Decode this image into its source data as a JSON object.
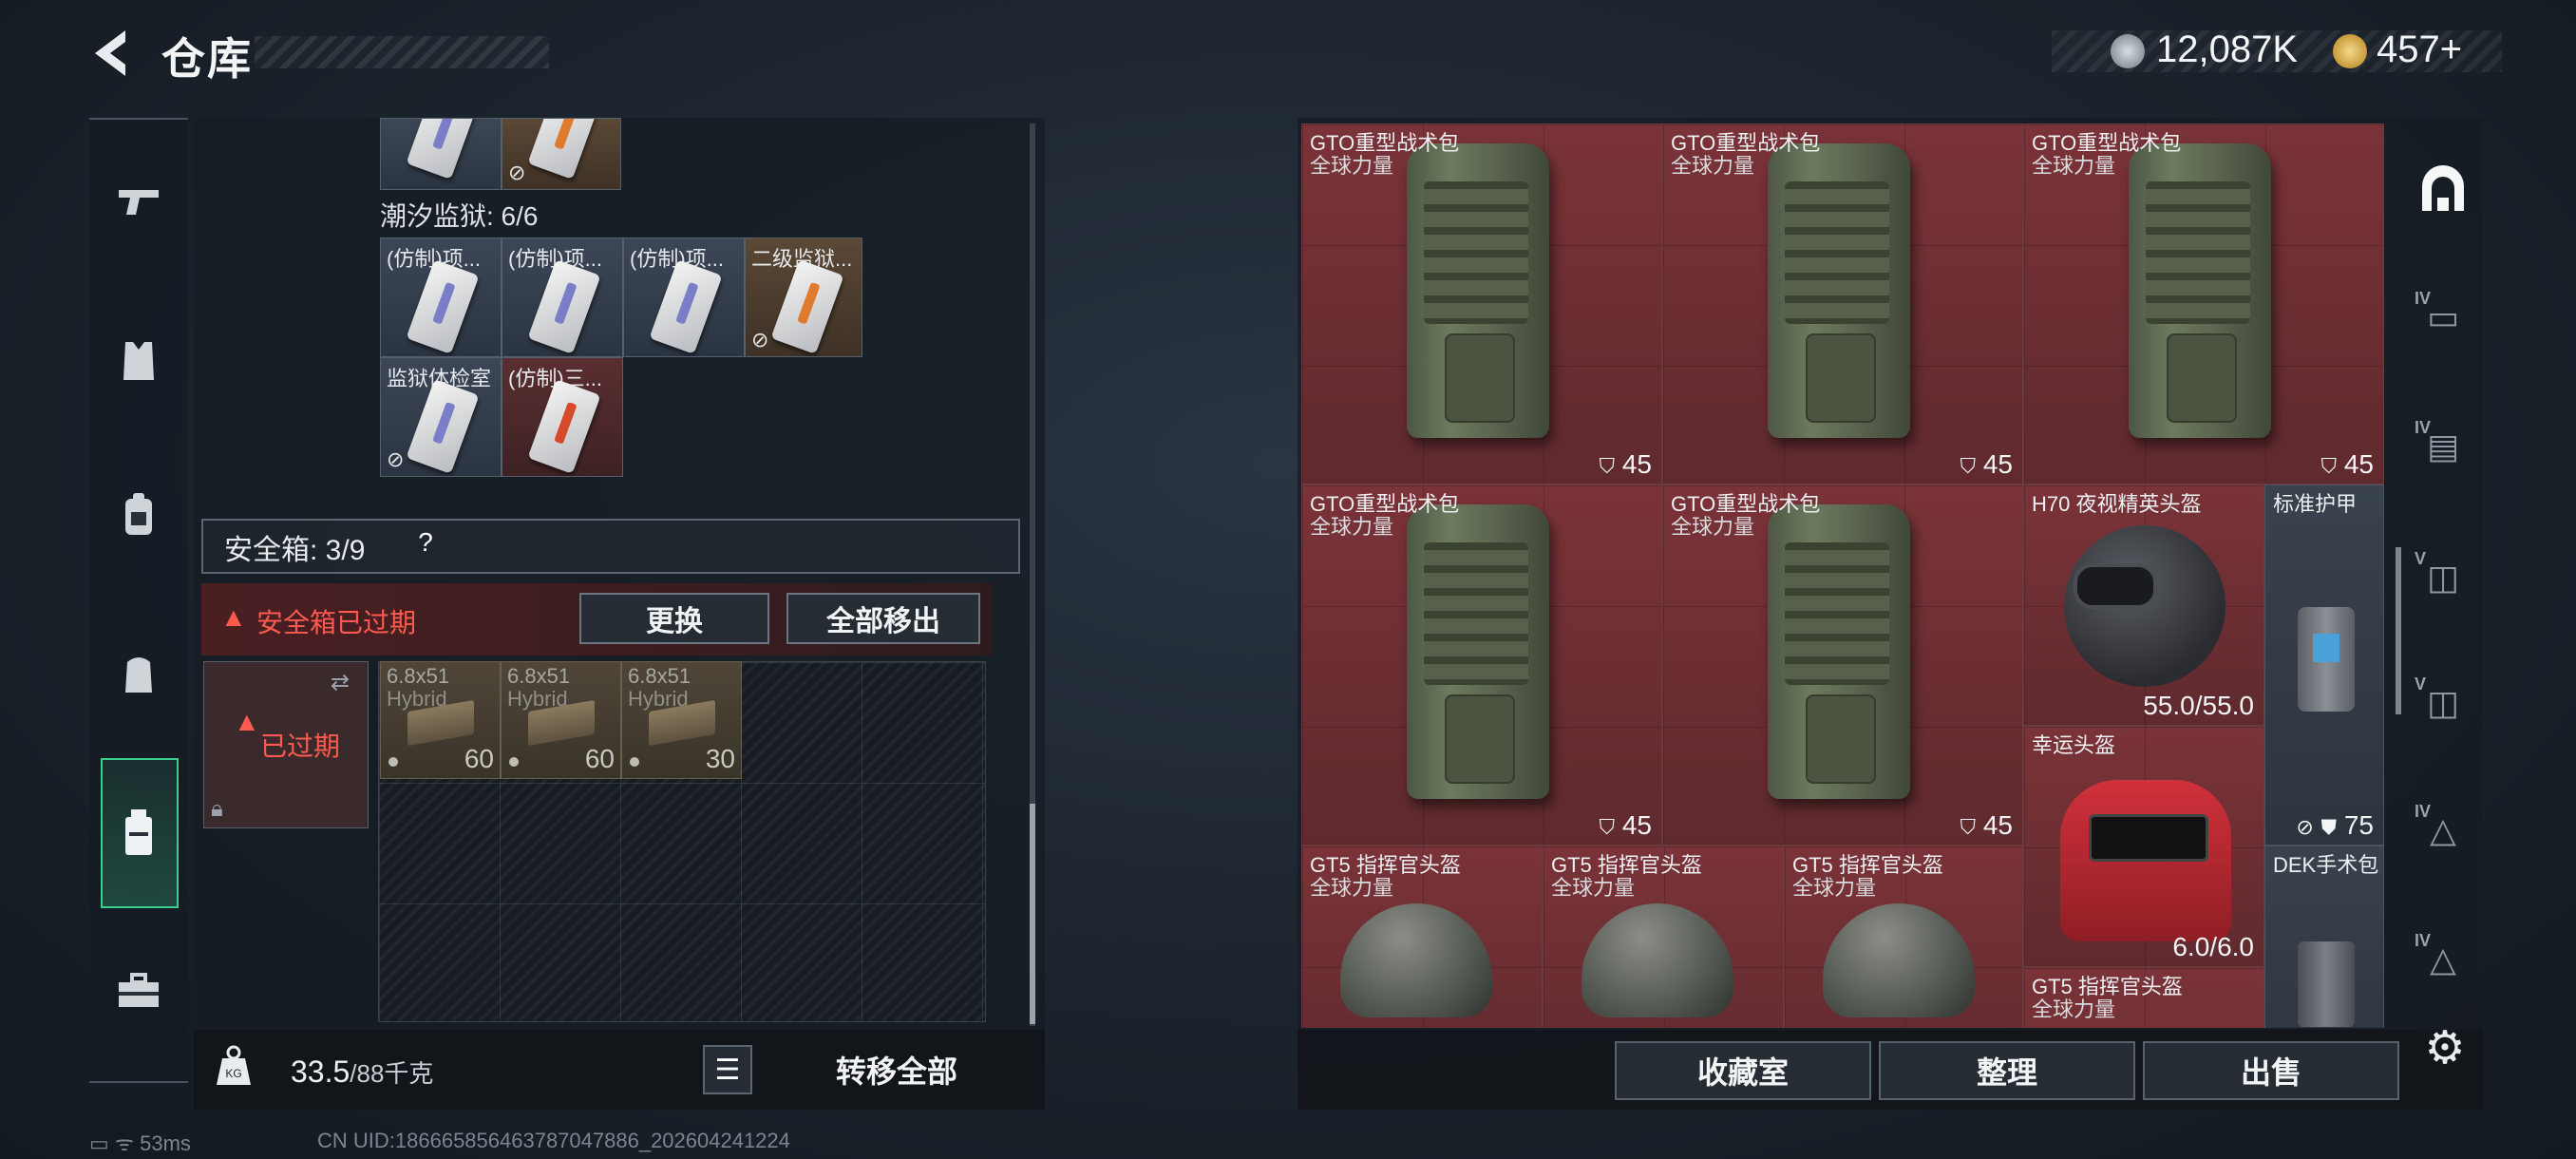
{
  "header": {
    "title": "仓库",
    "currencies": [
      {
        "icon": "silver-coin-icon",
        "value": "12,087K"
      },
      {
        "icon": "gold-coin-icon",
        "value": "457+"
      }
    ]
  },
  "left_nav": [
    "weapon-tab",
    "armor-tab",
    "backpack-tab",
    "chest-rig-tab",
    "storage-case-tab",
    "toolbox-tab"
  ],
  "keys_section": {
    "label": "潮汐监狱: 6/6",
    "items": [
      {
        "label": "(仿制)项..."
      },
      {
        "label": "(仿制)项..."
      },
      {
        "label": "(仿制)项..."
      },
      {
        "label": "二级监狱..."
      },
      {
        "label": "监狱体检室"
      },
      {
        "label": "(仿制)三..."
      }
    ]
  },
  "safe_box": {
    "title": "安全箱: 3/9",
    "help": "?",
    "warning": "安全箱已过期",
    "replace_btn": "更换",
    "remove_all_btn": "全部移出",
    "case_status": "已过期",
    "ammo": [
      {
        "name": "6.8x51",
        "sub": "Hybrid",
        "count": "60"
      },
      {
        "name": "6.8x51",
        "sub": "Hybrid",
        "count": "60"
      },
      {
        "name": "6.8x51",
        "sub": "Hybrid",
        "count": "30"
      }
    ]
  },
  "footer_left": {
    "weight": "33.5",
    "weight_cap": "/88千克",
    "transfer_all": "转移全部"
  },
  "status": {
    "ping": "53ms",
    "uid": "CN UID:1866658564637870478​86_202604241224"
  },
  "stash": {
    "items": [
      {
        "name": "GTO重型战术包",
        "sub": "全球力量",
        "value": "45"
      },
      {
        "name": "GTO重型战术包",
        "sub": "全球力量",
        "value": "45"
      },
      {
        "name": "GTO重型战术包",
        "sub": "全球力量",
        "value": "45"
      },
      {
        "name": "GTO重型战术包",
        "sub": "全球力量",
        "value": "45"
      },
      {
        "name": "GTO重型战术包",
        "sub": "全球力量",
        "value": "45"
      },
      {
        "name": "H70 夜视精英头盔",
        "value": "55.0/55.0"
      },
      {
        "name": "标准护甲",
        "value": "75"
      },
      {
        "name": "幸运头盔",
        "value": "6.0/6.0"
      },
      {
        "name": "DEK手术包"
      },
      {
        "name": "GT5 指挥官头盔",
        "sub": "全球力量"
      },
      {
        "name": "GT5 指挥官头盔",
        "sub": "全球力量"
      },
      {
        "name": "GT5 指挥官头盔",
        "sub": "全球力量"
      },
      {
        "name": "GT5 指挥官头盔",
        "sub": "全球力量"
      }
    ]
  },
  "bottom_buttons": {
    "collection": "收藏室",
    "sort": "整理",
    "sell": "出售"
  },
  "rail_tags": [
    "IV",
    "IV",
    "V",
    "V",
    "IV",
    "IV"
  ]
}
